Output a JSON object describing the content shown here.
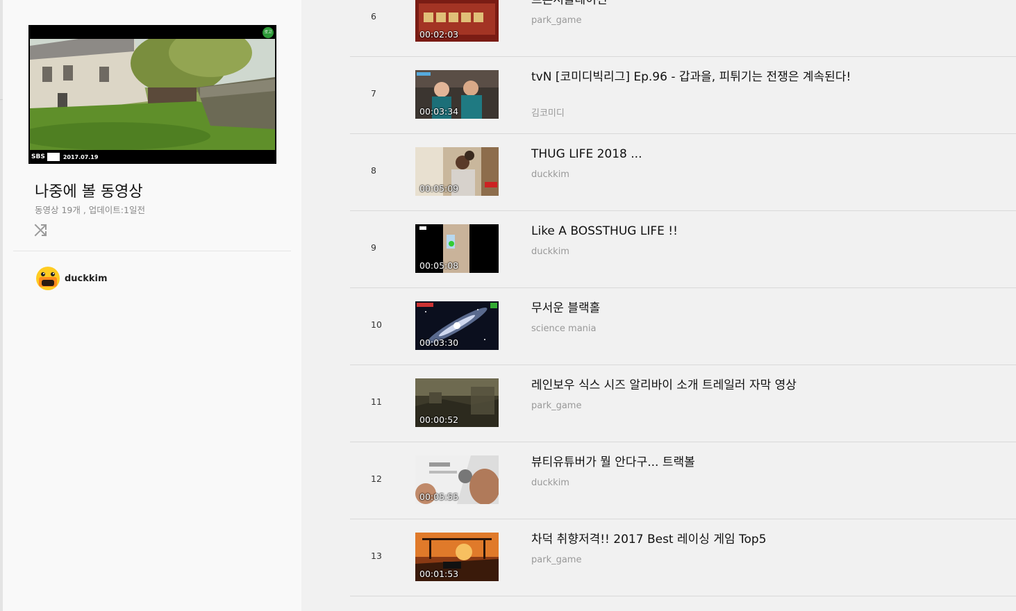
{
  "playlist": {
    "title": "나중에 볼 동영상",
    "meta": "동영상 19개 , 업데이트:1일전",
    "cover": {
      "broadcaster": "SBS",
      "date": "2017.07.19",
      "badge": "로고"
    },
    "shuffle_icon": "shuffle-icon"
  },
  "owner": {
    "name": "duckkim",
    "avatar_icon": "duck-avatar-icon"
  },
  "videos": [
    {
      "index": "6",
      "title": "트론서울레이션",
      "channel": "park_game",
      "duration": "00:02:03"
    },
    {
      "index": "7",
      "title": "tvN [코미디빅리그] Ep.96 - 갑과을, 피튀기는 전쟁은 계속된다!",
      "channel": "김코미디",
      "duration": "00:03:34"
    },
    {
      "index": "8",
      "title": "THUG LIFE 2018 ...",
      "channel": "duckkim",
      "duration": "00:05:09"
    },
    {
      "index": "9",
      "title": "Like A BOSSTHUG LIFE !!",
      "channel": "duckkim",
      "duration": "00:05:08"
    },
    {
      "index": "10",
      "title": "무서운 블랙홀",
      "channel": "science mania",
      "duration": "00:03:30"
    },
    {
      "index": "11",
      "title": "레인보우 식스 시즈 알리바이 소개 트레일러 자막 영상",
      "channel": "park_game",
      "duration": "00:00:52"
    },
    {
      "index": "12",
      "title": "뷰티유튜버가 뭘 안다구... 트랙볼",
      "channel": "duckkim",
      "duration": "00:05:55"
    },
    {
      "index": "13",
      "title": "차덕 취향저격!! 2017 Best 레이싱 게임 Top5",
      "channel": "park_game",
      "duration": "00:01:53"
    }
  ],
  "colors": {
    "panel_bg": "#f9f9f9",
    "page_bg": "#f1f1f1",
    "channel_text": "#999999"
  }
}
